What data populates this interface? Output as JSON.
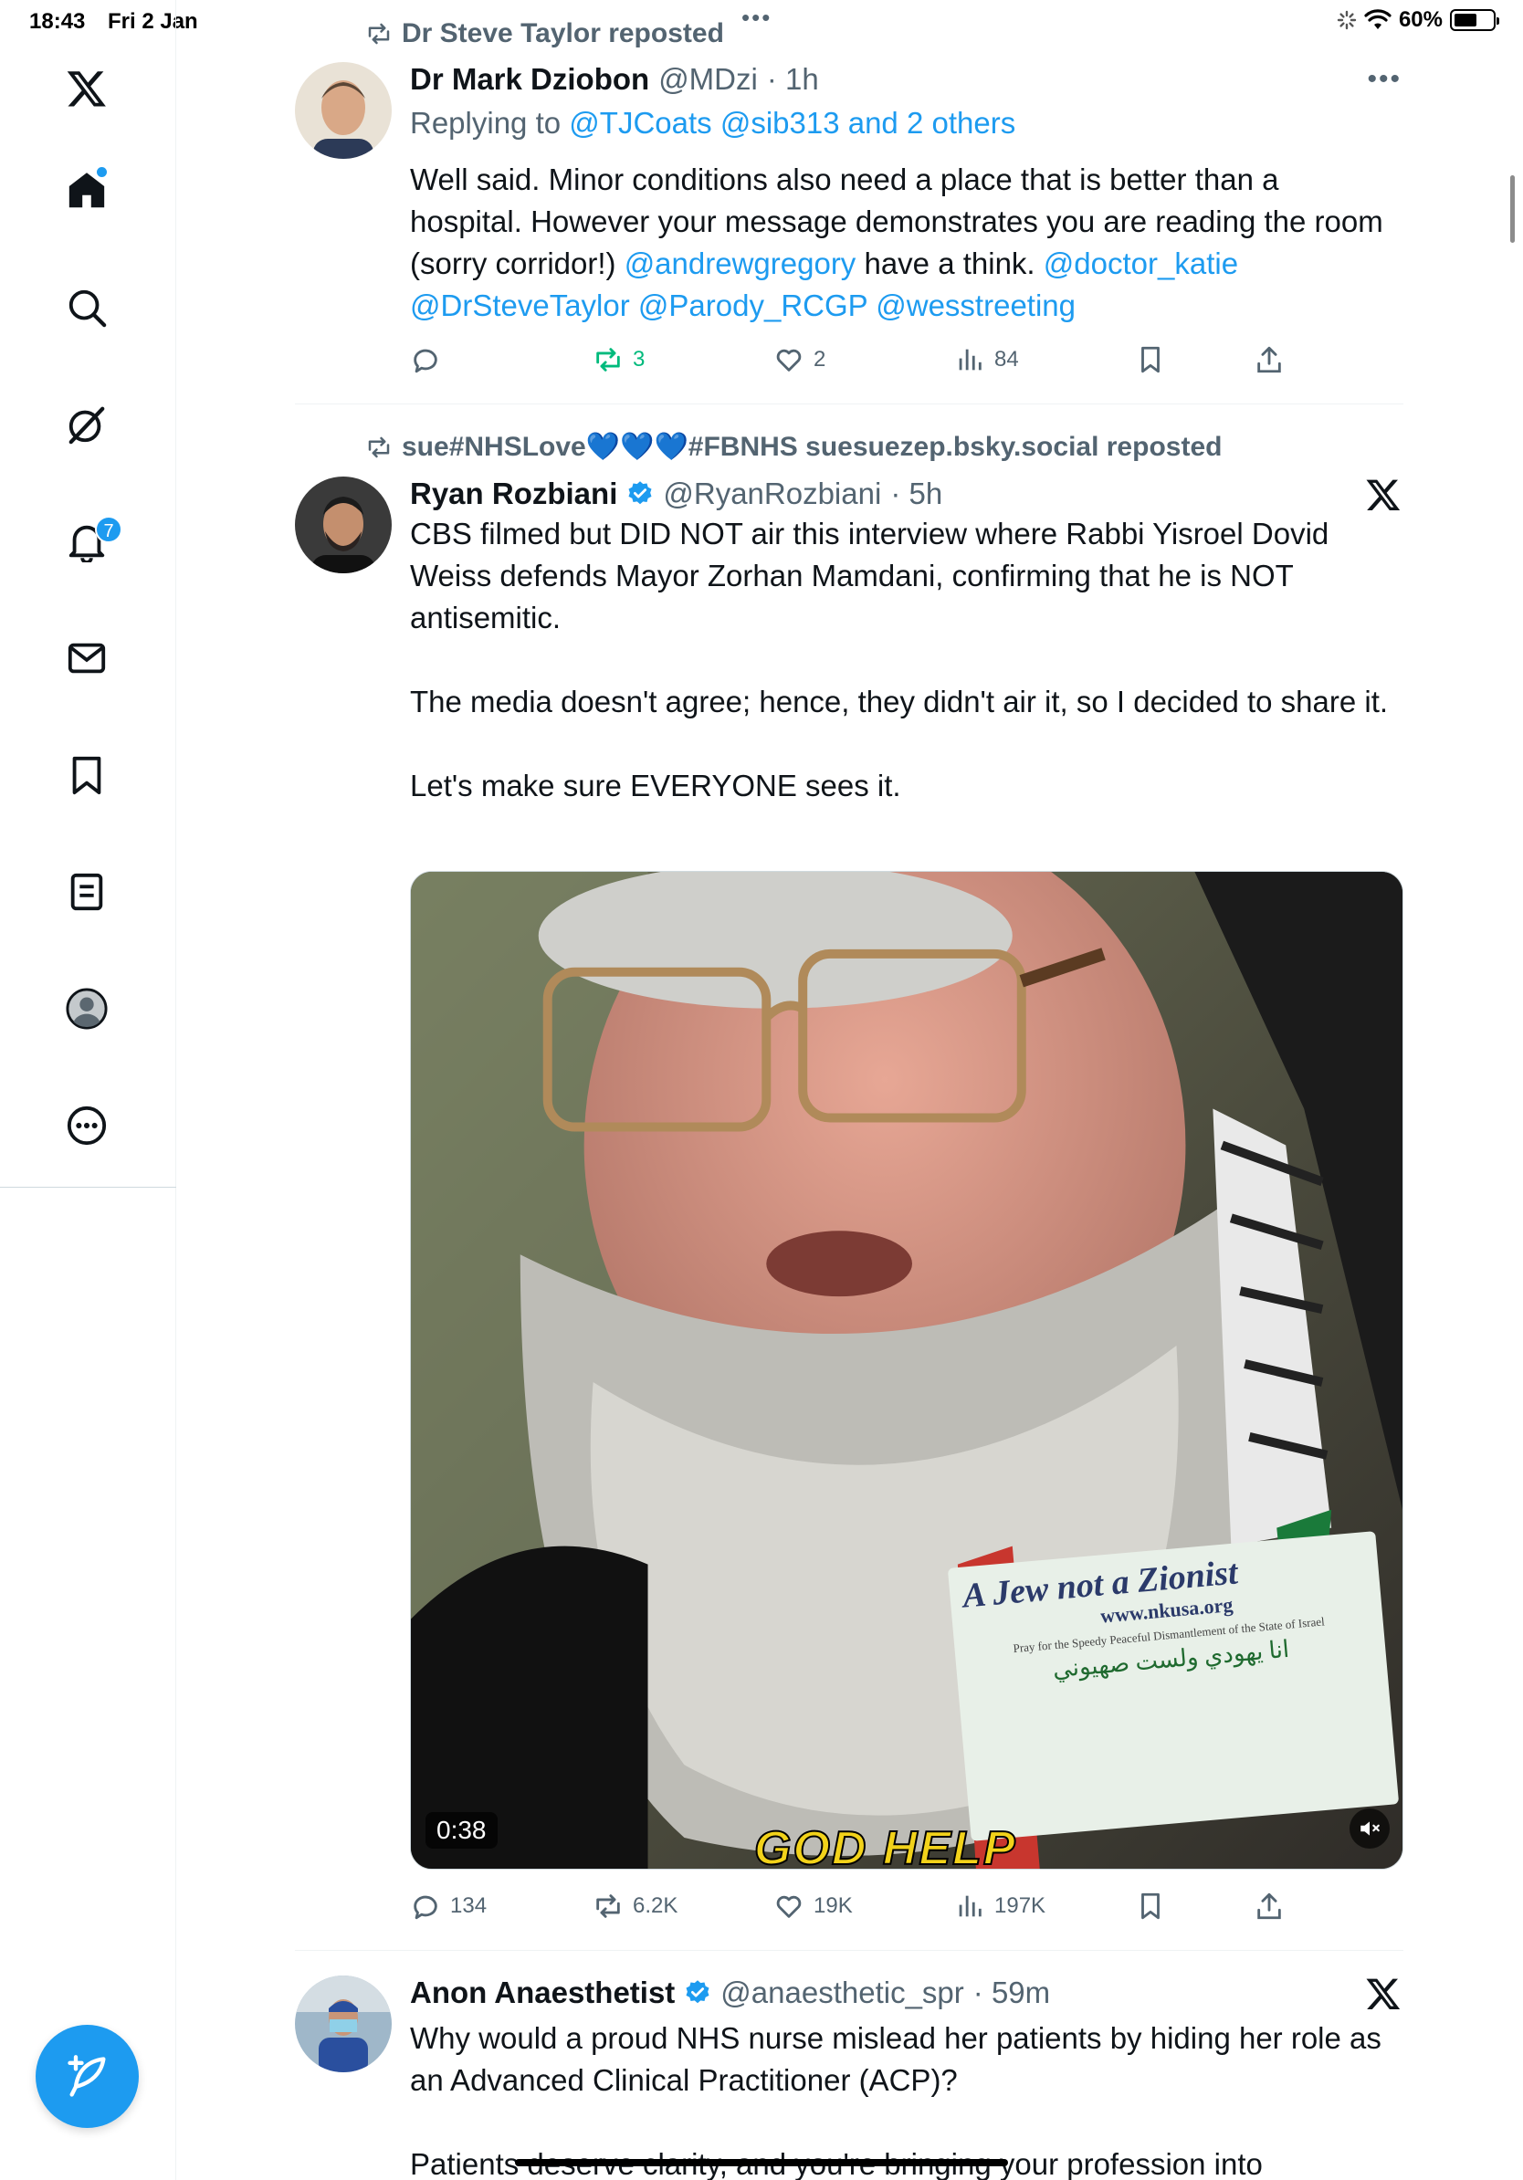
{
  "status_bar": {
    "time": "18:43",
    "date": "Fri 2 Jan",
    "battery": "60%",
    "battery_level": 0.6
  },
  "sidebar": {
    "items": [
      {
        "id": "logo",
        "icon": "x-logo-icon"
      },
      {
        "id": "home",
        "icon": "home-icon"
      },
      {
        "id": "search",
        "icon": "search-icon"
      },
      {
        "id": "grok",
        "icon": "grok-icon"
      },
      {
        "id": "notifications",
        "icon": "bell-icon",
        "badge": "7"
      },
      {
        "id": "messages",
        "icon": "envelope-icon"
      },
      {
        "id": "bookmarks",
        "icon": "bookmark-icon"
      },
      {
        "id": "lists",
        "icon": "list-icon"
      },
      {
        "id": "profile",
        "icon": "avatar-icon"
      },
      {
        "id": "more",
        "icon": "more-circle-icon"
      }
    ],
    "compose_icon": "compose-feather-icon"
  },
  "accent_color": "#1d9bf0",
  "tweets": [
    {
      "repost_by": "Dr Steve Taylor reposted",
      "name": "Dr Mark Dziobon",
      "handle": "@MDzi",
      "time": "· 1h",
      "replying_prefix": "Replying to",
      "replying_to": "@TJCoats @sib313 and 2 others",
      "body": [
        [
          {
            "t": "Well said. Minor conditions also need a place that is better than a hospital. However your message demonstrates you are reading the room (sorry corridor!) "
          },
          {
            "t": "@andrewgregory",
            "m": true
          },
          {
            "t": " have a think. "
          },
          {
            "t": "@doctor_katie",
            "m": true
          },
          {
            "t": " "
          },
          {
            "t": "@DrSteveTaylor",
            "m": true
          },
          {
            "t": " "
          },
          {
            "t": "@Parody_RCGP",
            "m": true
          },
          {
            "t": " "
          },
          {
            "t": "@wesstreeting",
            "m": true
          }
        ]
      ],
      "stats": {
        "replies": "",
        "reposts": "3",
        "likes": "2",
        "views": "84"
      }
    },
    {
      "repost_by": "sue#NHSLove💙💙💙#FBNHS suesuezep.bsky.social reposted",
      "name": "Ryan Rozbiani",
      "handle": "@RyanRozbiani",
      "time": "· 5h",
      "verified": true,
      "body": [
        [
          {
            "t": "CBS filmed but DID NOT air this interview where Rabbi Yisroel Dovid Weiss defends Mayor Zorhan Mamdani, confirming that he is NOT antisemitic."
          }
        ],
        [],
        [
          {
            "t": "The media doesn't agree; hence, they didn't air it, so I decided to share it."
          }
        ],
        [],
        [
          {
            "t": "Let's make sure EVERYONE sees it."
          }
        ]
      ],
      "video": {
        "duration": "0:38",
        "sign_line1": "A Jew not a Zionist",
        "sign_line2": "www.nkusa.org",
        "sign_line3": "Pray for the\nSpeedy Peaceful Dismantlement of the State of Israel",
        "sign_line4": "انا يهودي ولست صهيوني",
        "caption": "GOD HELP"
      },
      "stats": {
        "replies": "134",
        "reposts": "6.2K",
        "likes": "19K",
        "views": "197K"
      }
    },
    {
      "name": "Anon Anaesthetist",
      "handle": "@anaesthetic_spr",
      "time": "· 59m",
      "verified": true,
      "body": [
        [
          {
            "t": "Why would a proud NHS nurse mislead her patients by hiding her role as an Advanced Clinical Practitioner (ACP)?"
          }
        ],
        [],
        [
          {
            "t": "Patients deserve clarity, and you're bringing your profession into"
          }
        ]
      ]
    }
  ]
}
